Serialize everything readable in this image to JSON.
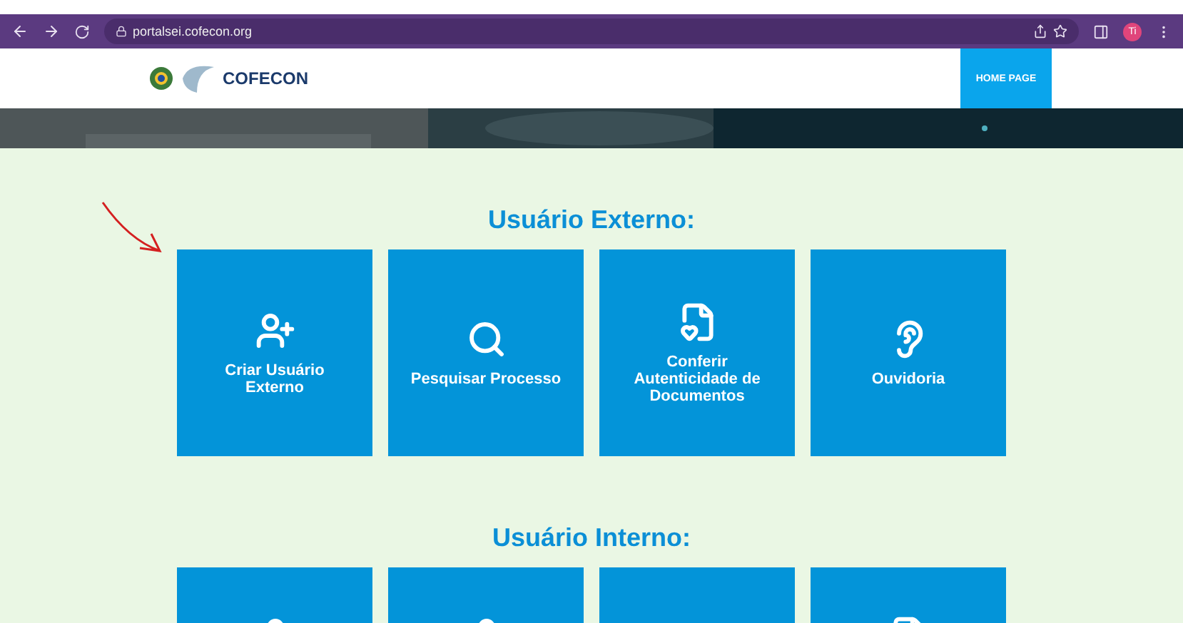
{
  "browser": {
    "url": "portalsei.cofecon.org",
    "profile": "Ti"
  },
  "header": {
    "logo_text": "COFECON",
    "nav": [
      {
        "label": "HOME PAGE",
        "selected": true
      }
    ]
  },
  "sections": [
    {
      "title": "Usuário Externo:",
      "tiles": [
        {
          "label": "Criar Usuário Externo",
          "kind": "useradd"
        },
        {
          "label": "Pesquisar Processo",
          "kind": "search"
        },
        {
          "label": "Conferir Autenticidade de Documentos",
          "kind": "document"
        },
        {
          "label": "Ouvidoria",
          "kind": "hearing"
        }
      ]
    },
    {
      "title": "Usuário Interno:",
      "tiles": [
        {
          "kind": "person"
        },
        {
          "kind": "person"
        },
        {
          "kind": "blank"
        },
        {
          "kind": "page"
        }
      ]
    }
  ]
}
